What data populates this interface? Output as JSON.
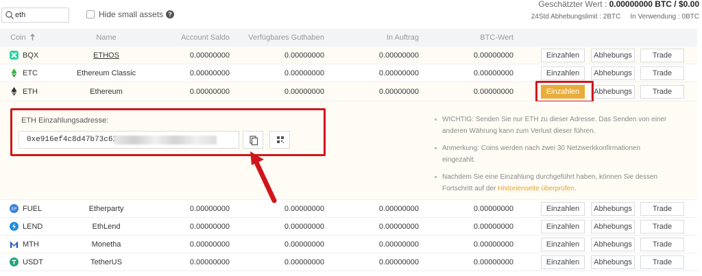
{
  "search": {
    "value": "eth",
    "placeholder": ""
  },
  "hide_small_assets": {
    "label": "Hide small assets",
    "checked": false
  },
  "header": {
    "estimated_label": "Geschätzter Wert :",
    "estimated_value": "0.00000000 BTC / $0.00",
    "withdraw_limit": "24Std Abhebungslimit : 2BTC",
    "in_use": "In Verwendung : 0BTC"
  },
  "columns": [
    "Coin",
    "Name",
    "Account Saldo",
    "Verfügbares Guthaben",
    "In Auftrag",
    "BTC-Wert"
  ],
  "buttons": {
    "deposit": "Einzahlen",
    "withdraw": "Abhebungs",
    "trade": "Trade"
  },
  "rows": [
    {
      "coin": "BQX",
      "name": "ETHOS",
      "balance": "0.00000000",
      "available": "0.00000000",
      "in_order": "0.00000000",
      "btc_value": "0.00000000"
    },
    {
      "coin": "ETC",
      "name": "Ethereum Classic",
      "balance": "0.00000000",
      "available": "0.00000000",
      "in_order": "0.00000000",
      "btc_value": "0.00000000"
    },
    {
      "coin": "ETH",
      "name": "Ethereum",
      "balance": "0.00000000",
      "available": "0.00000000",
      "in_order": "0.00000000",
      "btc_value": "0.00000000"
    },
    {
      "coin": "FUEL",
      "name": "Etherparty",
      "balance": "0.00000000",
      "available": "0.00000000",
      "in_order": "0.00000000",
      "btc_value": "0.00000000"
    },
    {
      "coin": "LEND",
      "name": "EthLend",
      "balance": "0.00000000",
      "available": "0.00000000",
      "in_order": "0.00000000",
      "btc_value": "0.00000000"
    },
    {
      "coin": "MTH",
      "name": "Monetha",
      "balance": "0.00000000",
      "available": "0.00000000",
      "in_order": "0.00000000",
      "btc_value": "0.00000000"
    },
    {
      "coin": "USDT",
      "name": "TetherUS",
      "balance": "0.00000000",
      "available": "0.00000000",
      "in_order": "0.00000000",
      "btc_value": "0.00000000"
    }
  ],
  "deposit_panel": {
    "address_label": "ETH Einzahlungsadresse:",
    "address_visible": "0xe916ef4c8d47b73c62",
    "notes": {
      "n1": "WICHTIG: Senden Sie nur ETH zu dieser Adresse. Das Senden von einer anderen Währung kann zum Verlust dieser führen.",
      "n2": "Anmerkung: Coins werden nach zwei 30 Netzwerkkonfirmationen eingezahlt.",
      "n3_pre": "Nachdem Sie eine Einzahlung durchgeführt haben, können Sie dessen Fortschritt auf der ",
      "n3_link": "Historienseite überprüfen",
      "n3_post": "."
    }
  },
  "colors": {
    "accent": "#e8ad3a",
    "annotation_red": "#d0161b",
    "link": "#e8a22f"
  }
}
